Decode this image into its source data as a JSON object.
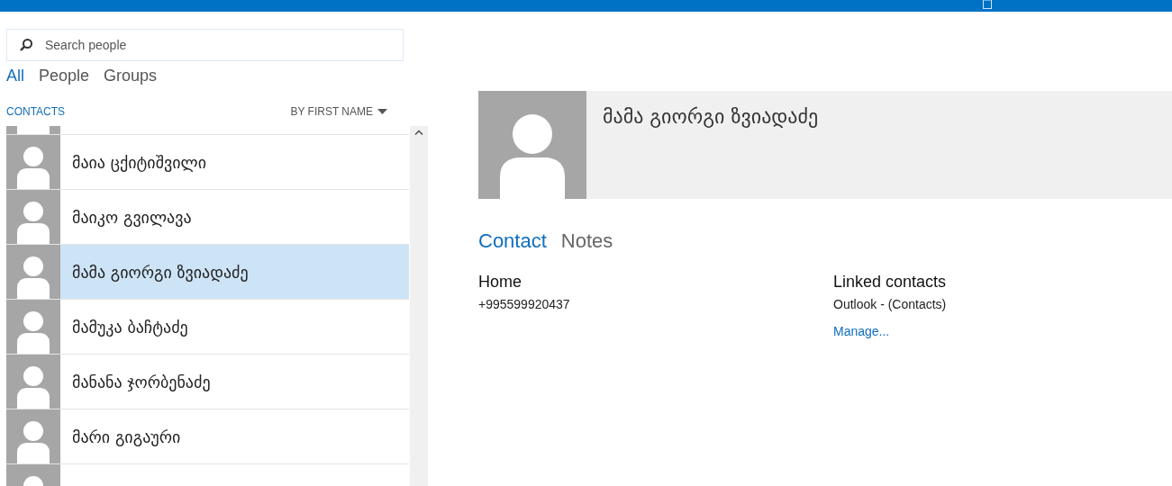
{
  "search": {
    "placeholder": "Search people"
  },
  "filters": [
    {
      "label": "All",
      "selected": true
    },
    {
      "label": "People",
      "selected": false
    },
    {
      "label": "Groups",
      "selected": false
    }
  ],
  "list_header": {
    "title": "CONTACTS",
    "sort": "BY FIRST NAME"
  },
  "contacts": [
    {
      "name": "მაია ცქიტიშვილი",
      "selected": false
    },
    {
      "name": "მაიკო გვილავა",
      "selected": false
    },
    {
      "name": "მამა გიორგი ზვიადაძე",
      "selected": true
    },
    {
      "name": "მამუკა ბაჩტაძე",
      "selected": false
    },
    {
      "name": "მანანა ჯორბენაძე",
      "selected": false
    },
    {
      "name": "მარი გიგაური",
      "selected": false
    }
  ],
  "detail": {
    "name": "მამა გიორგი ზვიადაძე",
    "tabs": [
      {
        "label": "Contact",
        "selected": true
      },
      {
        "label": "Notes",
        "selected": false
      }
    ],
    "phone": {
      "label": "Home",
      "value": "+995599920437"
    },
    "linked": {
      "label": "Linked contacts",
      "source": "Outlook - (Contacts)",
      "action": "Manage..."
    }
  }
}
